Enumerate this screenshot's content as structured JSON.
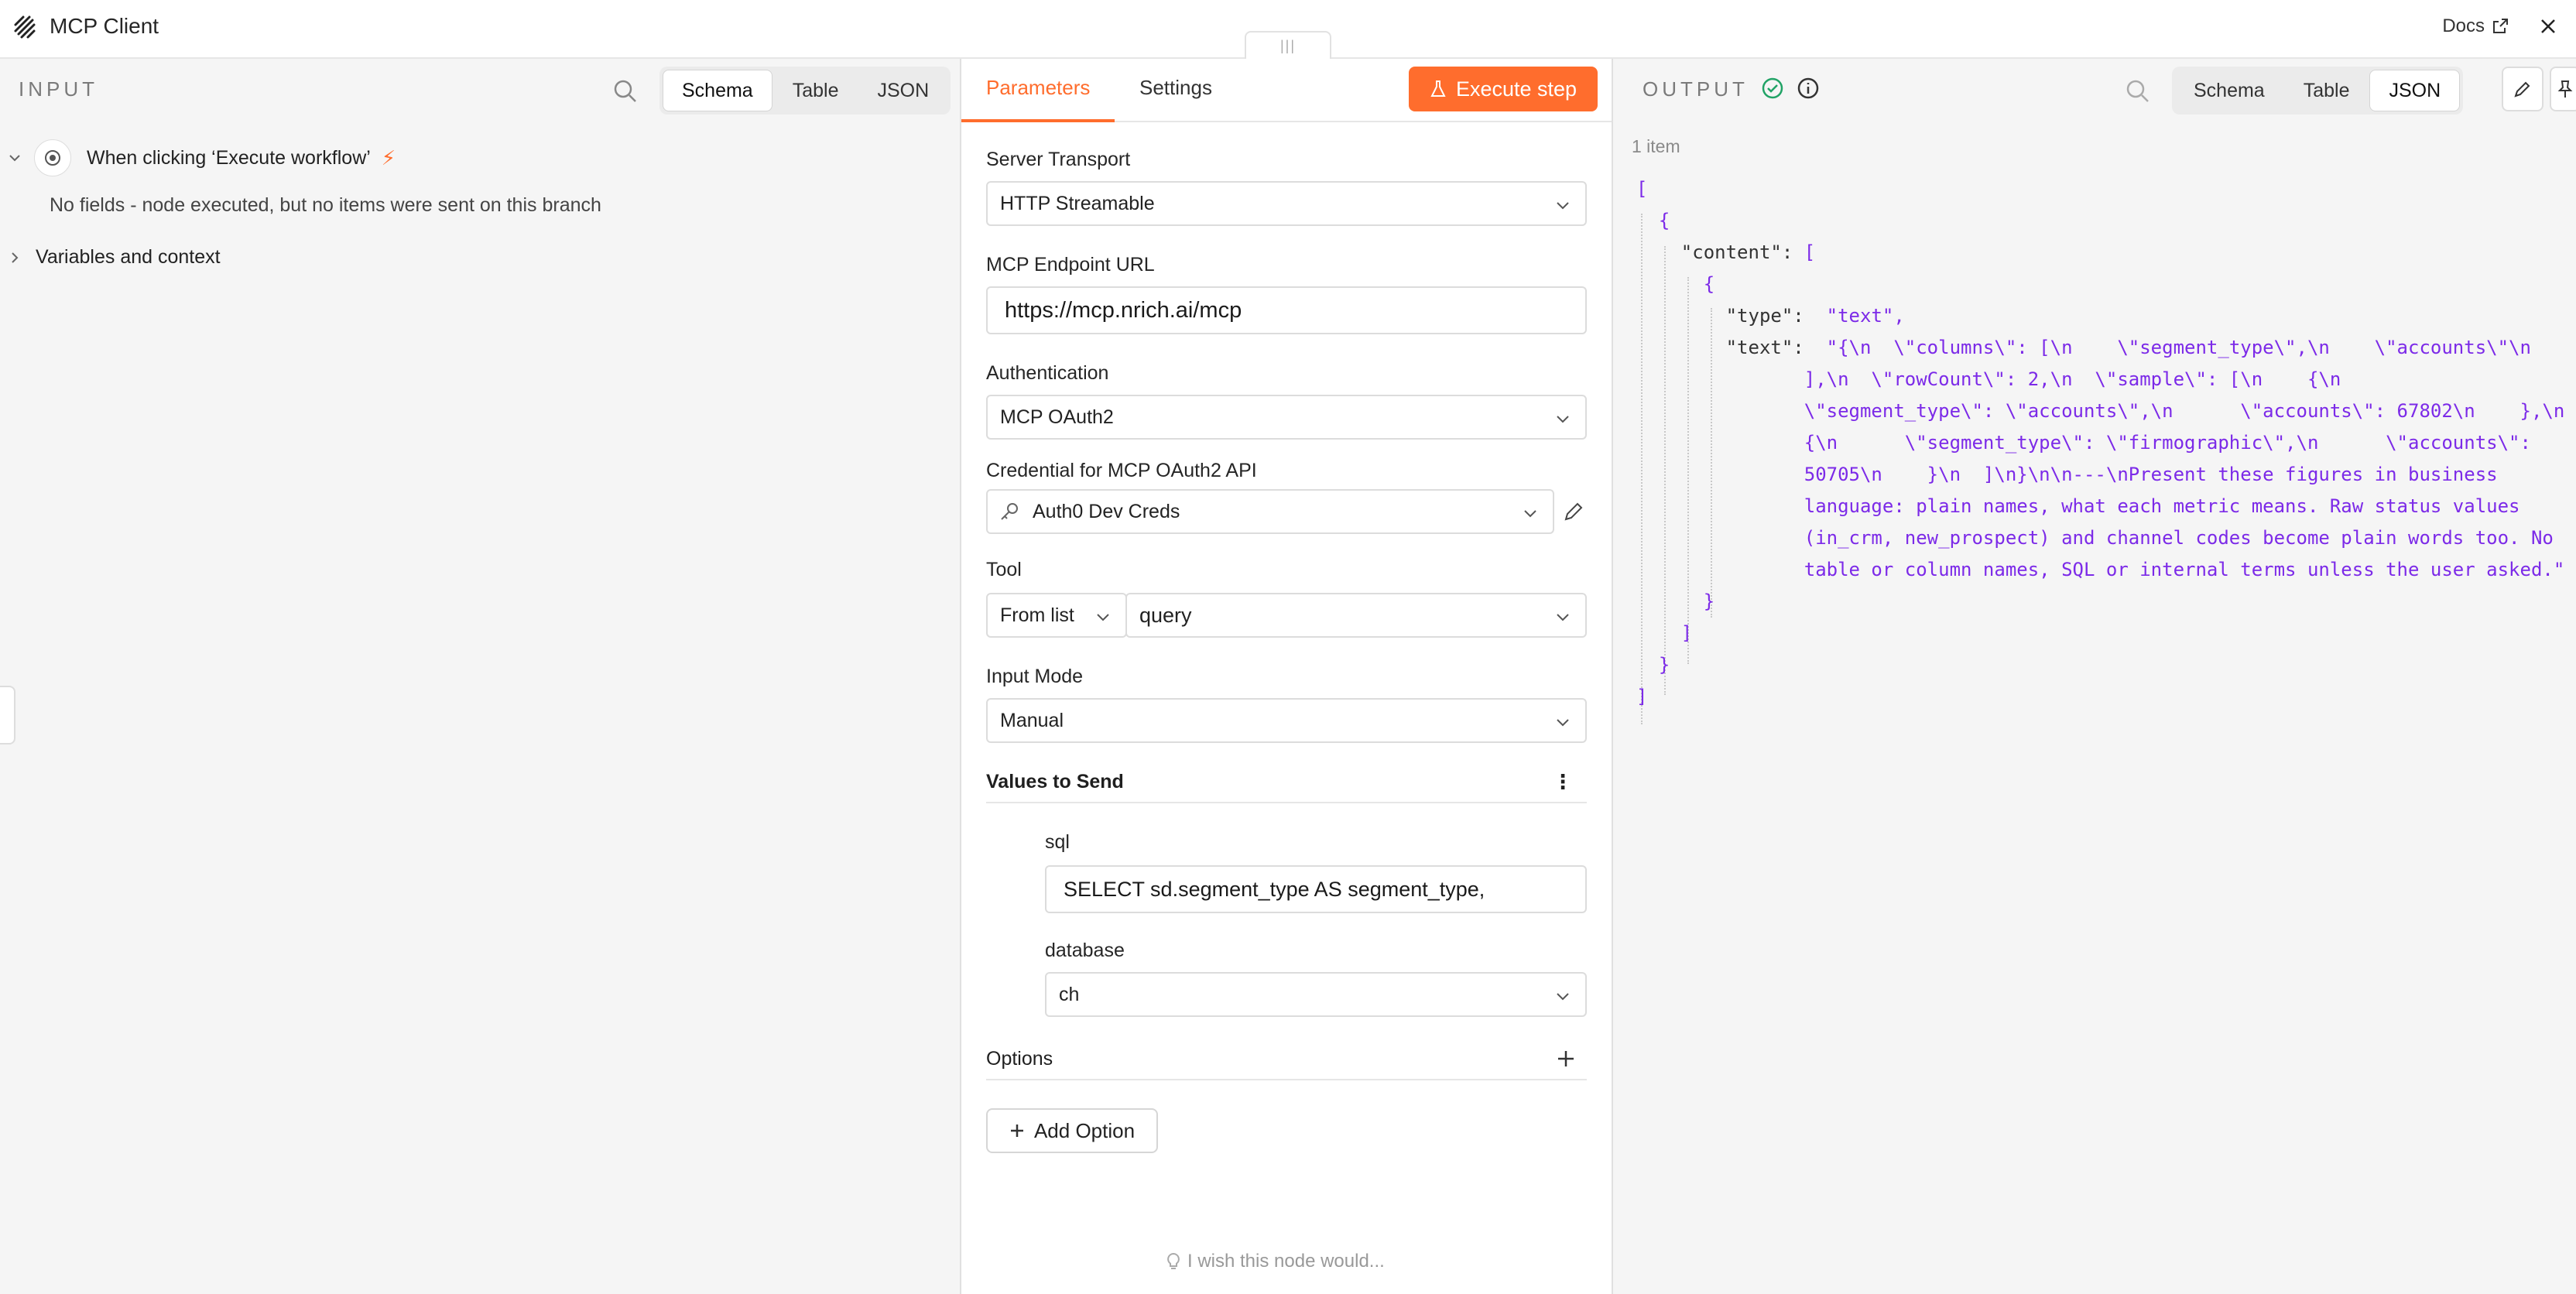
{
  "app": {
    "title": "MCP Client",
    "docs_label": "Docs"
  },
  "input": {
    "label": "INPUT",
    "view_tabs": [
      "Schema",
      "Table",
      "JSON"
    ],
    "active_view": "Schema",
    "trigger_node": "When clicking ‘Execute workflow’",
    "empty_message": "No fields - node executed, but no items were sent on this branch",
    "variables_label": "Variables and context"
  },
  "params": {
    "tabs": [
      "Parameters",
      "Settings"
    ],
    "active_tab": "Parameters",
    "execute_label": "Execute step",
    "server_transport": {
      "label": "Server Transport",
      "value": "HTTP Streamable"
    },
    "endpoint": {
      "label": "MCP Endpoint URL",
      "value": "https://mcp.nrich.ai/mcp"
    },
    "authentication": {
      "label": "Authentication",
      "value": "MCP OAuth2"
    },
    "credential": {
      "label": "Credential for MCP OAuth2 API",
      "value": "Auth0 Dev Creds"
    },
    "tool": {
      "label": "Tool",
      "mode": "From list",
      "value": "query"
    },
    "input_mode": {
      "label": "Input Mode",
      "value": "Manual"
    },
    "values_to_send": {
      "label": "Values to Send",
      "sql": {
        "label": "sql",
        "value": "SELECT sd.segment_type AS segment_type,"
      },
      "database": {
        "label": "database",
        "value": "ch"
      }
    },
    "options_label": "Options",
    "add_option_label": "Add Option",
    "wish_label": "I wish this node would..."
  },
  "output": {
    "label": "OUTPUT",
    "view_tabs": [
      "Schema",
      "Table",
      "JSON"
    ],
    "active_view": "JSON",
    "item_count": "1 item",
    "json_lines": [
      "[",
      "  {",
      "    \"content\": [",
      "      {",
      "        \"type\":  \"text\",",
      "        \"text\":  \"{\\n  \\\"columns\\\": [\\n    \\\"segment_type\\\",\\n    \\\"accounts\\\"\\n",
      "               ],\\n  \\\"rowCount\\\": 2,\\n  \\\"sample\\\": [\\n    {\\n",
      "               \\\"segment_type\\\": \\\"accounts\\\",\\n      \\\"accounts\\\": 67802\\n    },\\n",
      "               {\\n      \\\"segment_type\\\": \\\"firmographic\\\",\\n      \\\"accounts\\\":",
      "               50705\\n    }\\n  ]\\n}\\n\\n---\\nPresent these figures in business",
      "               language: plain names, what each metric means. Raw status values",
      "               (in_crm, new_prospect) and channel codes become plain words too. No",
      "               table or column names, SQL or internal terms unless the user asked.\"",
      "      }",
      "    ]",
      "  }",
      "]"
    ]
  },
  "colors": {
    "accent": "#ff6d2d",
    "json_value": "#7c2ae8",
    "success": "#21a366"
  }
}
